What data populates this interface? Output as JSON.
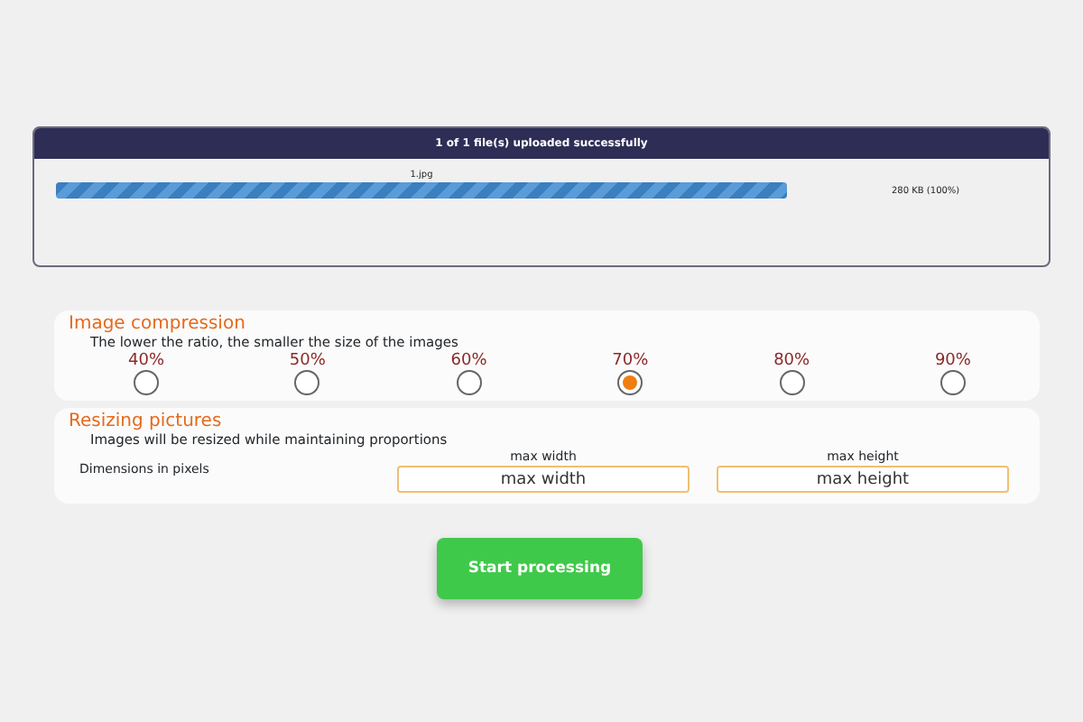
{
  "upload": {
    "title": "1 of 1 file(s) uploaded successfully",
    "file": {
      "name": "1.jpg",
      "level": 1,
      "size": "280 KB (100%)"
    }
  },
  "compression": {
    "title": "Image compression",
    "hint": "The lower the ratio, the smaller the size of the images",
    "options": [
      {
        "label": "40%",
        "selected": false
      },
      {
        "label": "50%",
        "selected": false
      },
      {
        "label": "60%",
        "selected": false
      },
      {
        "label": "70%",
        "selected": true
      },
      {
        "label": "80%",
        "selected": false
      },
      {
        "label": "90%",
        "selected": false
      }
    ]
  },
  "resize": {
    "title": "Resizing pictures",
    "hint": "Images will be resized while maintaining proportions",
    "row_label": "Dimensions in pixels",
    "fields": [
      {
        "label": "max width",
        "placeholder": "max width"
      },
      {
        "label": "max height",
        "placeholder": "max height"
      }
    ]
  },
  "button": "Start processing"
}
